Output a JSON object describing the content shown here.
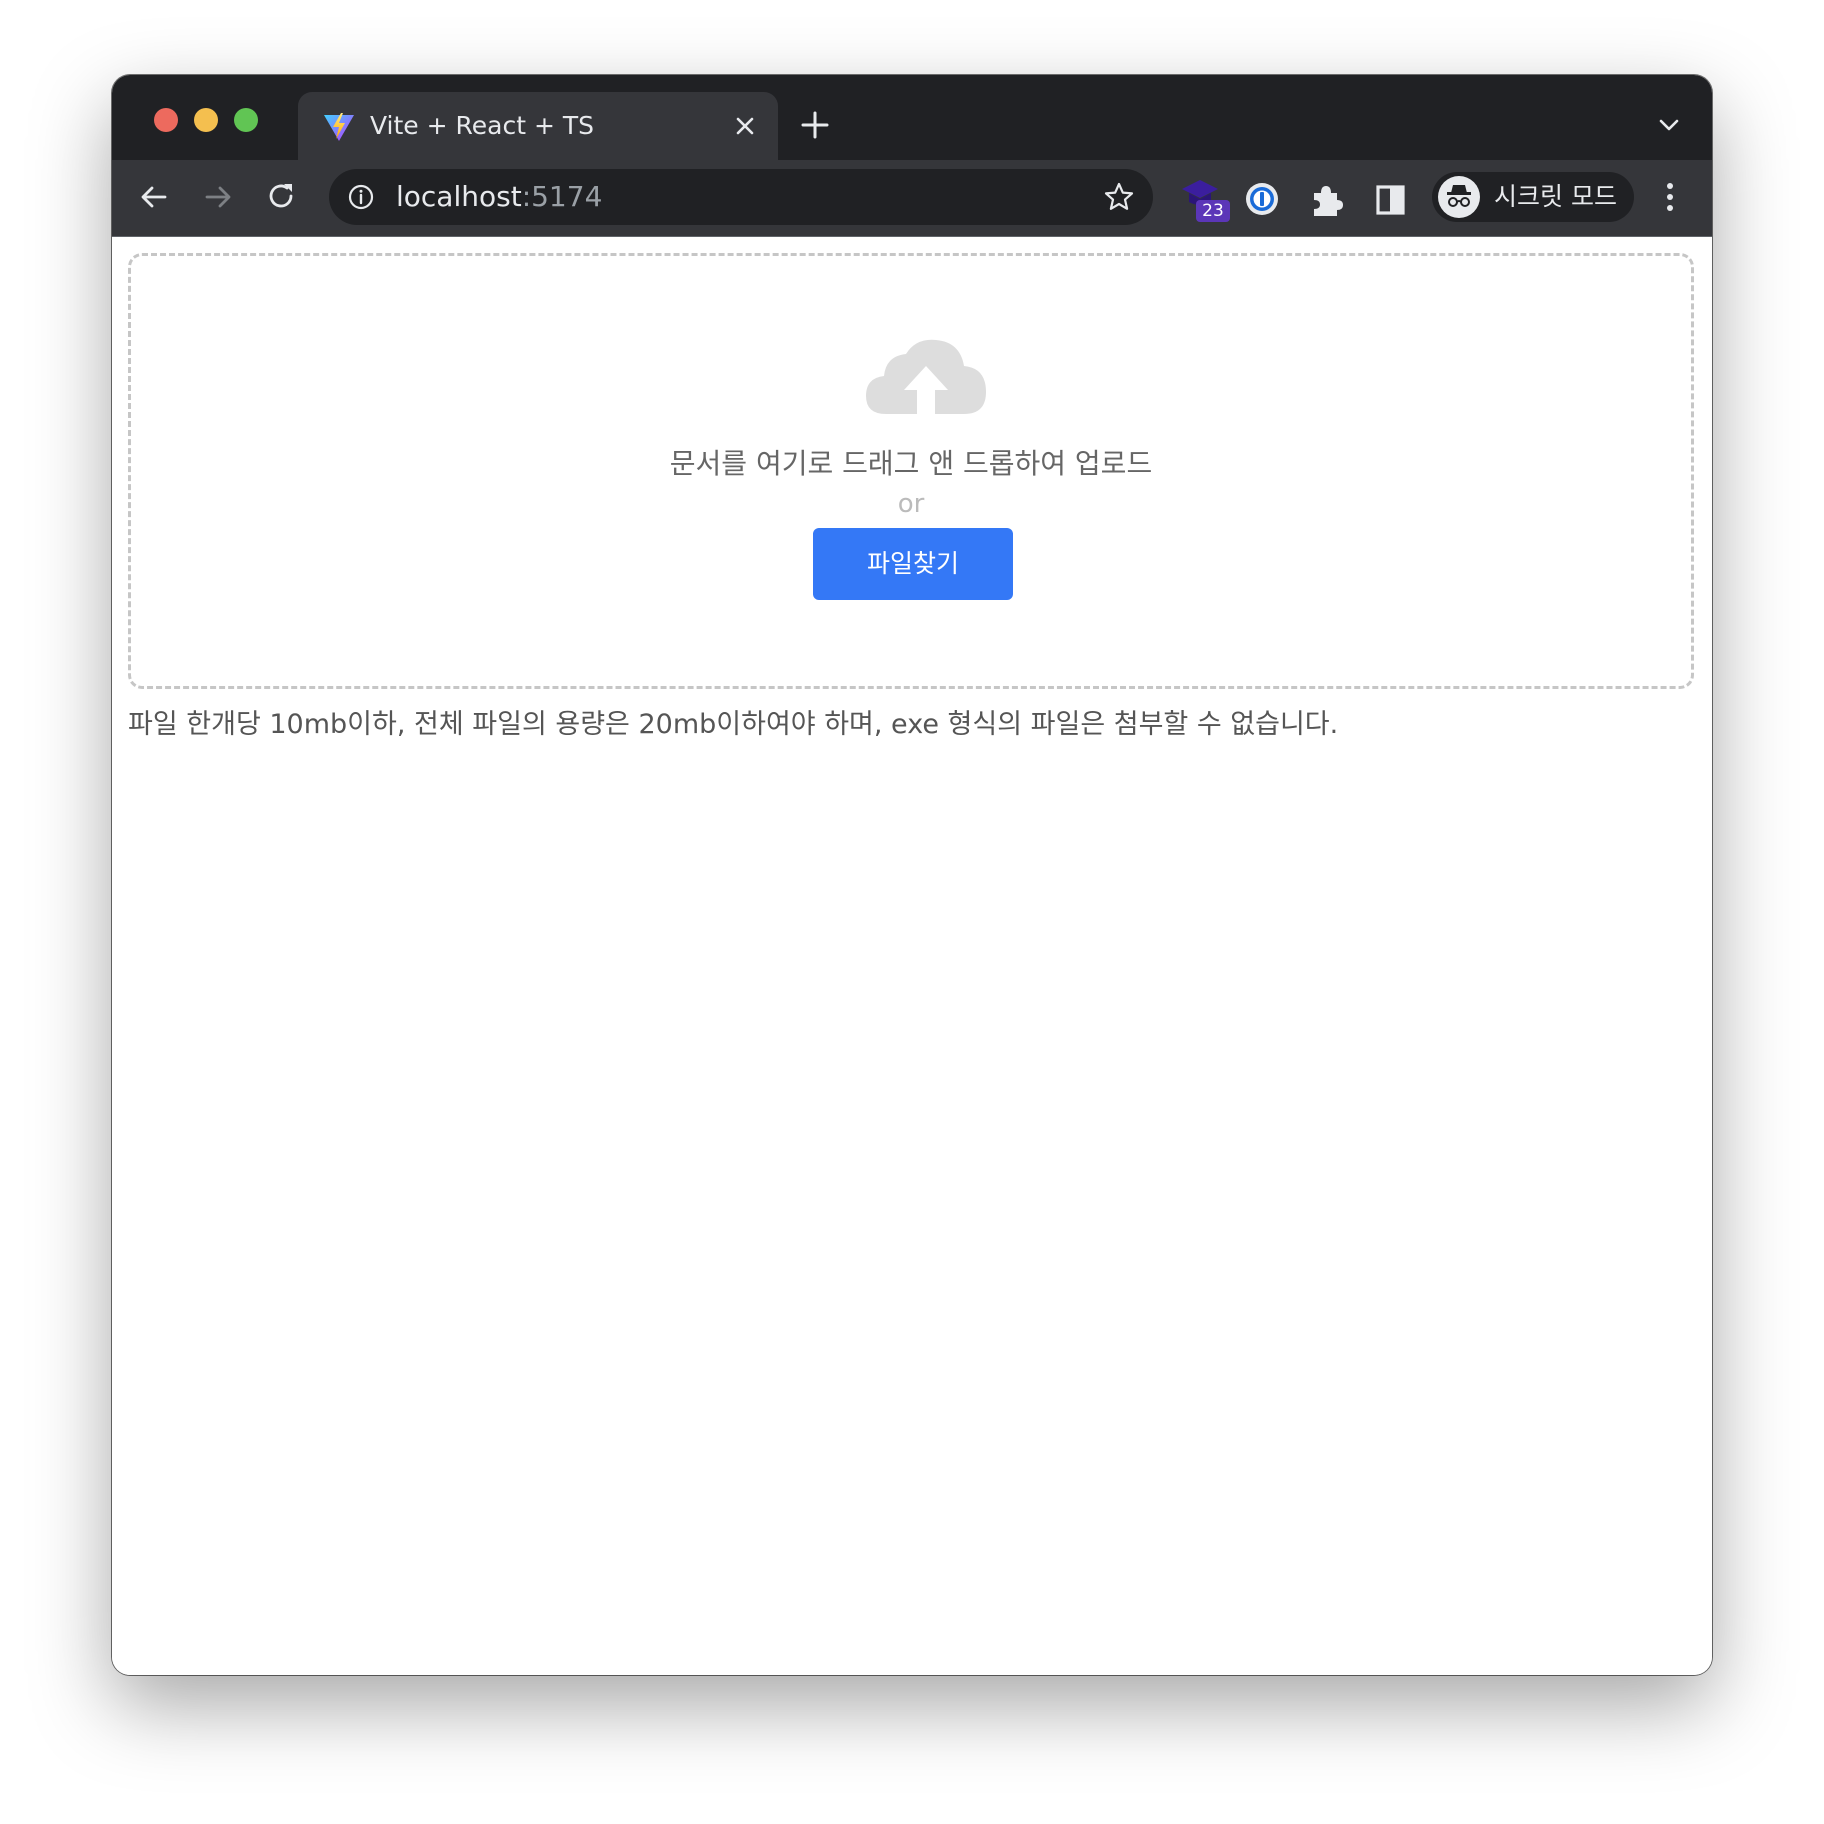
{
  "browser": {
    "tab": {
      "title": "Vite + React + TS",
      "favicon": "vite-logo-icon"
    },
    "address_bar": {
      "host": "localhost",
      "port": ":5174"
    },
    "extensions": [
      {
        "name": "graduation-cap-extension-icon",
        "badge": "23"
      },
      {
        "name": "password-manager-extension-icon"
      },
      {
        "name": "puzzle-extensions-icon"
      },
      {
        "name": "side-panel-icon"
      }
    ],
    "profile": {
      "label": "시크릿 모드",
      "icon": "incognito-icon"
    },
    "colors": {
      "tabstrip": "#202124",
      "toolbar": "#35363a",
      "traffic_close": "#ed6a5e",
      "traffic_minimize": "#f4bf4f",
      "traffic_maximize": "#61c554"
    }
  },
  "upload": {
    "icon": "cloud-upload-icon",
    "drop_text": "문서를 여기로 드래그 앤 드롭하여 업로드",
    "or_text": "or",
    "button_label": "파일찾기",
    "note": "파일 한개당 10mb이하, 전체 파일의 용량은 20mb이하여야 하며, exe 형식의 파일은 첨부할 수 없습니다.",
    "colors": {
      "button": "#3478f6",
      "dashed_border": "#c6c6c6",
      "icon": "#dddddd"
    }
  }
}
